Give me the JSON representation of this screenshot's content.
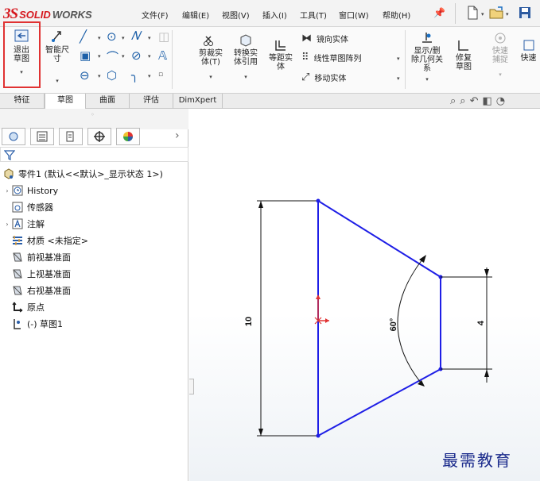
{
  "app": {
    "logo_prefix": "3S",
    "logo_text": "SOLID",
    "logo_text2": "WORKS"
  },
  "menu": {
    "file": "文件(F)",
    "edit": "编辑(E)",
    "view": "视图(V)",
    "insert": "插入(I)",
    "tools": "工具(T)",
    "window": "窗口(W)",
    "help": "帮助(H)"
  },
  "ribbon": {
    "exit_sketch": "退出草图",
    "smart_dim": "智能尺寸",
    "trim": "剪裁实体(T)",
    "convert": "转换实体引用",
    "offset": "等距实体",
    "mirror": "镜向实体",
    "linear_pattern": "线性草图阵列",
    "move": "移动实体",
    "display_delete": "显示/删除几何关系",
    "repair": "修复草图",
    "quick_snap": "快速捕捉",
    "quick": "快速"
  },
  "tabs": [
    "特征",
    "草图",
    "曲面",
    "评估",
    "DimXpert"
  ],
  "active_tab": 1,
  "tree": {
    "root": "零件1 (默认<<默认>_显示状态 1>)",
    "items": [
      {
        "label": "History",
        "expand": true
      },
      {
        "label": "传感器",
        "expand": false
      },
      {
        "label": "注解",
        "expand": true
      },
      {
        "label": "材质 <未指定>",
        "expand": false
      },
      {
        "label": "前视基准面",
        "expand": false
      },
      {
        "label": "上视基准面",
        "expand": false
      },
      {
        "label": "右视基准面",
        "expand": false
      },
      {
        "label": "原点",
        "expand": false
      },
      {
        "label": "(-) 草图1",
        "expand": false
      }
    ]
  },
  "sketch": {
    "dim_height": "10",
    "dim_right": "4",
    "dim_angle": "60°"
  },
  "watermark": "最需教育",
  "colors": {
    "sketch_line": "#1e1ee6",
    "dim_line": "#111111",
    "accent_red": "#e03232"
  }
}
